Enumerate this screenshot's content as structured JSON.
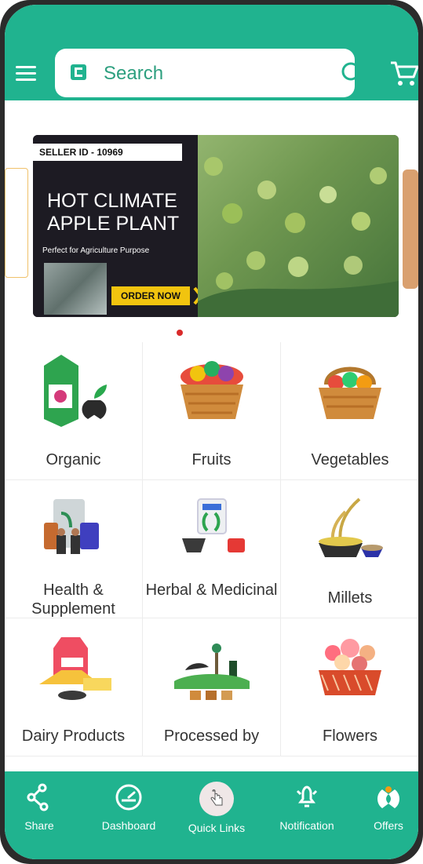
{
  "header": {
    "search_placeholder": "Search"
  },
  "banner": {
    "seller_id": "SELLER ID - 10969",
    "title": "HOT CLIMATE APPLE PLANT",
    "subtitle": "Perfect for Agriculture Purpose",
    "cta": "ORDER NOW"
  },
  "categories": [
    {
      "label": "Organic"
    },
    {
      "label": "Fruits"
    },
    {
      "label": "Vegetables"
    },
    {
      "label": "Health & Supplement"
    },
    {
      "label": "Herbal & Medicinal"
    },
    {
      "label": "Millets"
    },
    {
      "label": "Dairy Products"
    },
    {
      "label": "Processed by"
    },
    {
      "label": "Flowers"
    }
  ],
  "nav": [
    {
      "label": "Share"
    },
    {
      "label": "Dashboard"
    },
    {
      "label": "Quick Links"
    },
    {
      "label": "Notification"
    },
    {
      "label": "Offers"
    }
  ],
  "colors": {
    "primary": "#20b38f",
    "dot": "#d92a2a",
    "cta": "#f1c40f"
  }
}
